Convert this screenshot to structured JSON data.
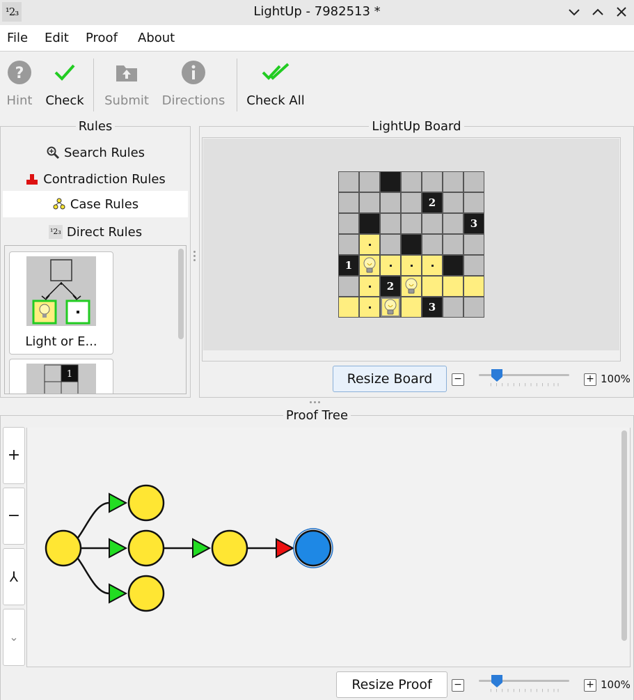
{
  "window": {
    "title": "LightUp - 7982513 *",
    "app_icon_text": "¹2₃"
  },
  "menu": {
    "file": "File",
    "edit": "Edit",
    "proof": "Proof",
    "about": "About"
  },
  "toolbar": {
    "hint": "Hint",
    "check": "Check",
    "submit": "Submit",
    "directions": "Directions",
    "check_all": "Check All"
  },
  "rules": {
    "title": "Rules",
    "tabs": [
      "Search Rules",
      "Contradiction Rules",
      "Case Rules",
      "Direct Rules"
    ],
    "active_tab": "Case Rules",
    "cards": [
      {
        "label": "Light or E..."
      },
      {
        "label": ""
      }
    ]
  },
  "board": {
    "title": "LightUp Board",
    "resize_label": "Resize Board",
    "zoom_label": "100%",
    "zoom_percent": 100,
    "cells": [
      [
        "u",
        "u",
        "b",
        "u",
        "u",
        "u",
        "u"
      ],
      [
        "u",
        "u",
        "u",
        "u",
        "b2",
        "u",
        "u"
      ],
      [
        "u",
        "b",
        "u",
        "u",
        "u",
        "u",
        "b3"
      ],
      [
        "u",
        "yd",
        "u",
        "b",
        "u",
        "u",
        "u"
      ],
      [
        "b1",
        "yL",
        "yd",
        "yd",
        "yd",
        "b",
        "u"
      ],
      [
        "u",
        "yd",
        "b2",
        "yL",
        "y",
        "y",
        "y"
      ],
      [
        "y",
        "yd",
        "yLs",
        "y",
        "b3",
        "u",
        "u"
      ]
    ]
  },
  "proof": {
    "title": "Proof Tree",
    "resize_label": "Resize Proof",
    "zoom_label": "100%",
    "zoom_percent": 100,
    "buttons": {
      "zoom_in": "+",
      "zoom_out": "−",
      "merge": "⅄",
      "collapse": "⌄"
    },
    "colors": {
      "node": "#ffe633",
      "selected_node": "#1e88e5",
      "valid_rule": "#22dd22",
      "invalid_rule": "#ee1111"
    }
  }
}
